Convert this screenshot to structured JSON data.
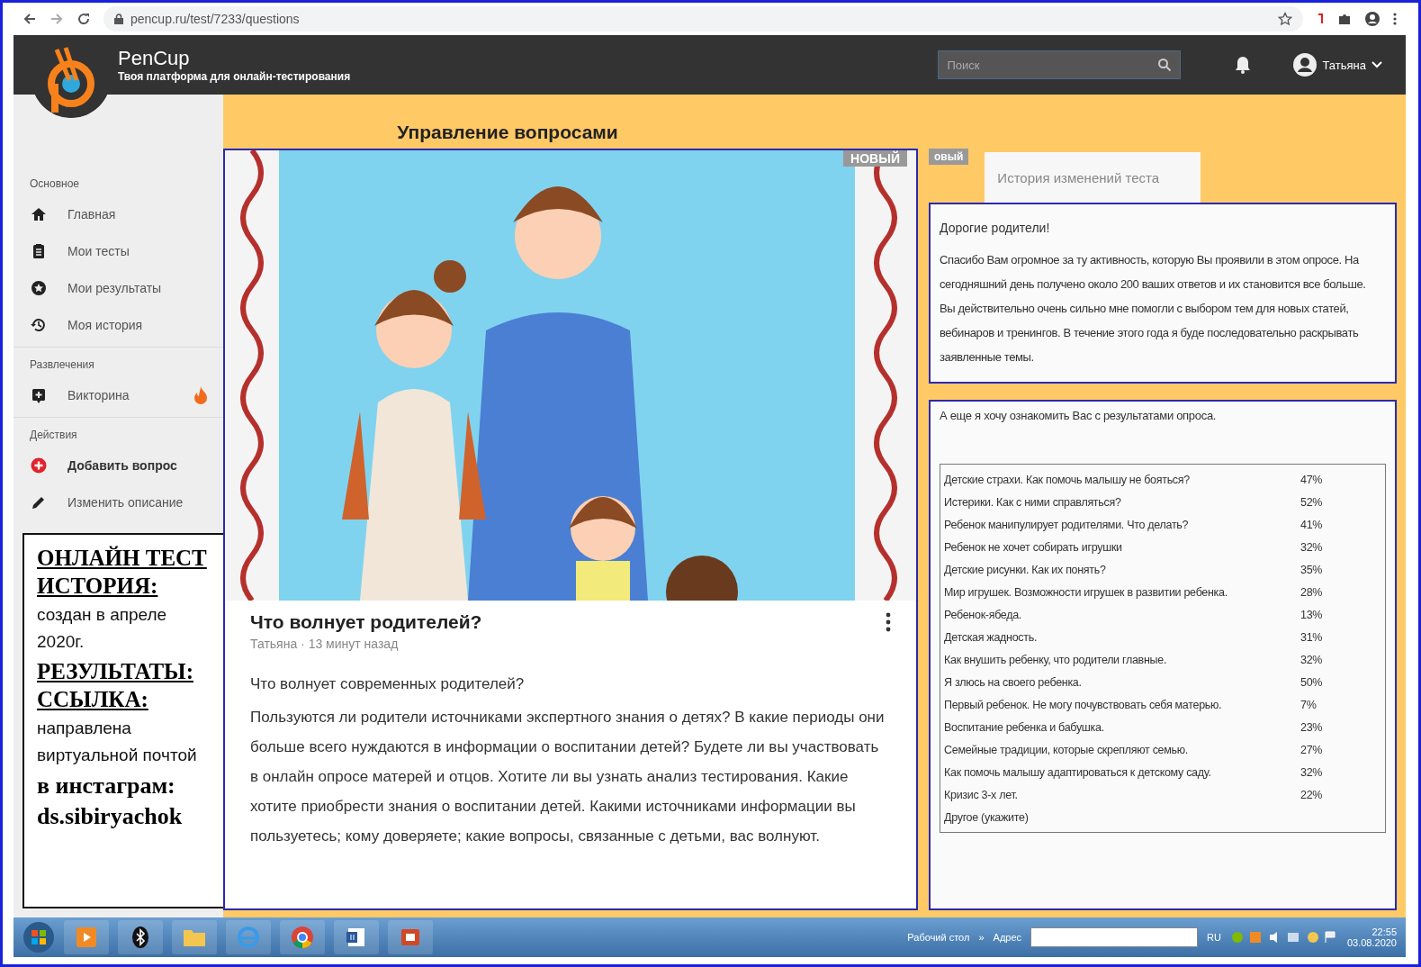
{
  "browser": {
    "url": "pencup.ru/test/7233/questions"
  },
  "header": {
    "brand": "PenCup",
    "tagline": "Твоя платформа для онлайн-тестирования",
    "search": {
      "placeholder": "Поиск"
    },
    "user": "Татьяна"
  },
  "sidebar": {
    "sections": [
      {
        "title": "Основное",
        "items": [
          {
            "label": "Главная",
            "kind": "home",
            "bold": false,
            "hot": false
          },
          {
            "label": "Мои тесты",
            "kind": "clipboard",
            "bold": false,
            "hot": false
          },
          {
            "label": "Мои результаты",
            "kind": "star",
            "bold": false,
            "hot": false
          },
          {
            "label": "Моя история",
            "kind": "history",
            "bold": false,
            "hot": false
          }
        ]
      },
      {
        "title": "Развлечения",
        "items": [
          {
            "label": "Викторина",
            "kind": "quiz",
            "bold": false,
            "hot": true
          }
        ]
      },
      {
        "title": "Действия",
        "items": [
          {
            "label": "Добавить вопрос",
            "kind": "add",
            "bold": true,
            "hot": false
          },
          {
            "label": "Изменить описание",
            "kind": "edit",
            "bold": false,
            "hot": false
          }
        ]
      }
    ]
  },
  "note": [
    {
      "kind": "heading",
      "text": "ОНЛАЙН ТЕСТ ИСТОРИЯ:"
    },
    {
      "kind": "text",
      "text": "создан в апреле 2020г."
    },
    {
      "kind": "heading",
      "text": "РЕЗУЛЬТАТЫ: ССЫЛКА:"
    },
    {
      "kind": "text",
      "text": "направлена виртуальной почтой"
    },
    {
      "kind": "strong",
      "text": "в инстаграм: ds.sibiryachok"
    }
  ],
  "page_title": "Управление вопросами",
  "question": {
    "badge": "НОВЫЙ",
    "title": "Что волнует родителей?",
    "meta": "Татьяна · 13 минут назад",
    "paragraphs": [
      "Что волнует современных родителей?",
      "Пользуются ли родители источниками экспертного знания о детях? В какие периоды они больше всего нуждаются в информации о воспитании детей? Будете ли вы участвовать в онлайн опросе матерей и отцов. Хотите ли вы узнать анализ тестирования. Какие хотите приобрести знания о воспитании детей. Какими источниками информации вы пользуетесь; кому доверяете; какие вопросы, связанные с детьми, вас волнуют."
    ]
  },
  "side_badge": "овый",
  "history_title": "История изменений теста",
  "letter": {
    "greeting": "Дорогие родители!",
    "paragraphs": [
      "Спасибо Вам огромное за ту активность, которую Вы проявили в этом опросе. На сегодняшний день получено около 200 ваших ответов и их становится все больше.",
      "Вы действительно очень сильно мне помогли с выбором тем для новых статей, вебинаров и тренингов. В течение этого года я буде последовательно раскрывать заявленные темы."
    ]
  },
  "results": {
    "intro": "А еще я хочу ознакомить Вас с результатами опроса.",
    "rows": [
      {
        "topic": "Детские страхи. Как помочь малышу не бояться?",
        "percent": "47%"
      },
      {
        "topic": "Истерики. Как с ними справляться?",
        "percent": "52%"
      },
      {
        "topic": "Ребенок манипулирует родителями. Что делать?",
        "percent": "41%"
      },
      {
        "topic": "Ребенок не хочет собирать игрушки",
        "percent": "32%"
      },
      {
        "topic": "Детские рисунки. Как их понять?",
        "percent": "35%"
      },
      {
        "topic": "Мир игрушек. Возможности игрушек в развитии ребенка.",
        "percent": "28%"
      },
      {
        "topic": "Ребенок-ябеда.",
        "percent": "13%"
      },
      {
        "topic": "Детская жадность.",
        "percent": "31%"
      },
      {
        "topic": "Как внушить ребенку, что родители главные.",
        "percent": "32%"
      },
      {
        "topic": "Я злюсь на своего ребенка.",
        "percent": "50%"
      },
      {
        "topic": "Первый ребенок. Не могу почувствовать себя матерью.",
        "percent": "7%"
      },
      {
        "topic": "Воспитание ребенка и бабушка.",
        "percent": "23%"
      },
      {
        "topic": "Семейные традиции, которые скрепляют семью.",
        "percent": "27%"
      },
      {
        "topic": "Как помочь малышу адаптироваться к детскому саду.",
        "percent": "32%"
      },
      {
        "topic": "Кризис 3-х лет.",
        "percent": "22%"
      },
      {
        "topic": "Другое (укажите)"
      }
    ]
  },
  "taskbar": {
    "desktop": "Рабочий стол",
    "chevron": "»",
    "address_label": "Адрес",
    "lang": "RU",
    "time": "22:55",
    "date": "03.08.2020"
  }
}
